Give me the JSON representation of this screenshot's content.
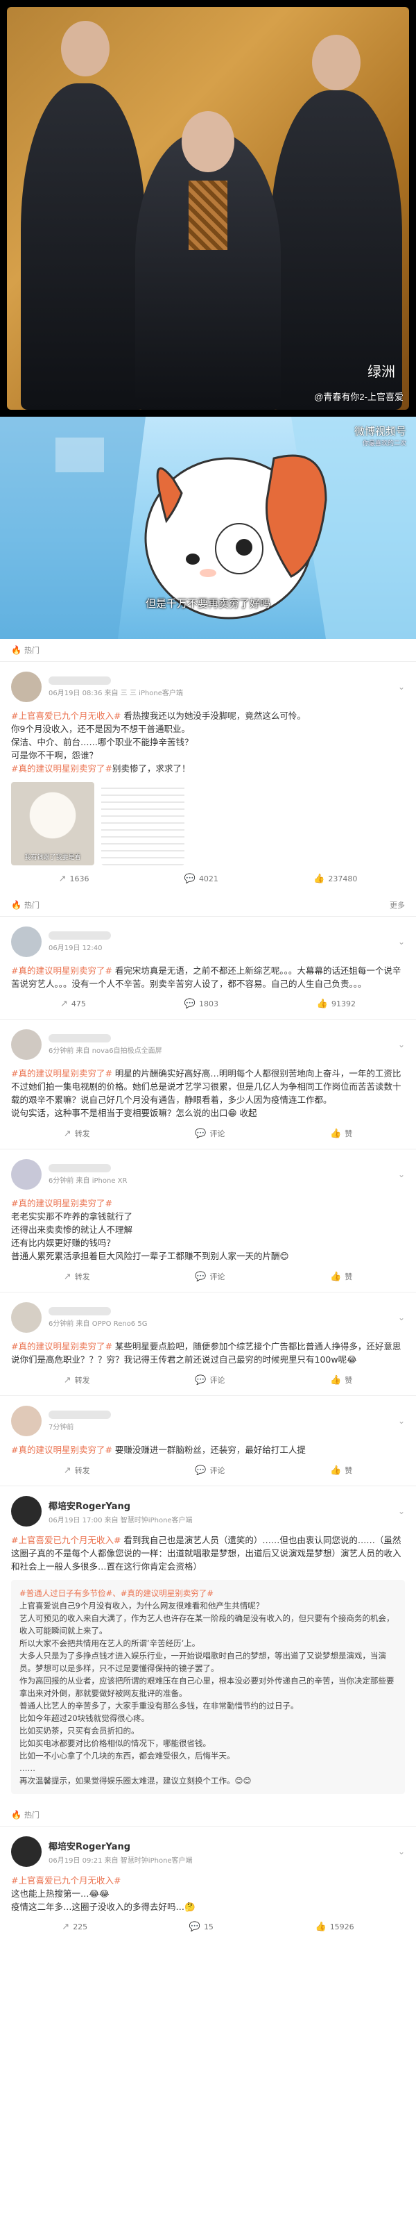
{
  "photo": {
    "watermark_logo": "绿洲",
    "watermark_account": "@青春有你2-上官喜爱"
  },
  "video": {
    "watermark": "微博视频号",
    "watermark_sub": "你最喜欢的二次",
    "subtitle": "但是千万不要再卖穷了好吗"
  },
  "hot_label": "热门",
  "more_label": "更多",
  "posts": [
    {
      "meta": "06月19日 08:36  来自 三 三  iPhone客户端",
      "lines": [
        {
          "tag": "#上官喜爱已九个月无收入#",
          "text": " 看热搜我还以为她没手没脚呢，竟然这么可怜。"
        },
        {
          "tag": "",
          "text": "你9个月没收入，还不是因为不想干普通职业。"
        },
        {
          "tag": "",
          "text": "保洁、中介、前台……哪个职业不能挣辛苦钱？"
        },
        {
          "tag": "",
          "text": "可是你不干啊，怨谁？"
        },
        {
          "tag": "#真的建议明星别卖穷了#",
          "text": "别卖惨了，求求了！"
        }
      ],
      "img1_caption": "我有钱跟了我要是看",
      "repost": "1636",
      "comment": "4021",
      "like": "237480"
    },
    {
      "meta": "06月19日 12:40",
      "lines": [
        {
          "tag": "#真的建议明星别卖穷了#",
          "text": " 看完宋坊真是无语，之前不都还上新综艺呢。。。大幕幕的话还姐每一个说辛苦说穷艺人。。。没有一个人不辛苦。别卖辛苦穷人设了，都不容易。自己的人生自己负责。。。"
        }
      ],
      "repost": "475",
      "comment": "1803",
      "like": "91392"
    },
    {
      "meta": "6分钟前  来自 nova6自拍极点全面屏",
      "lines": [
        {
          "tag": "#真的建议明星别卖穷了#",
          "text": " 明星的片酬确实好高好高…明明每个人都很别苦地向上奋斗，一年的工资比不过她们拍一集电视剧的价格。她们总是说才艺学习很累，但是几亿人为争相同工作岗位而苦苦读数十载的艰辛不累嘛？说自己好几个月没有通告，静眼看着，多少人因为疫情连工作都。"
        },
        {
          "tag": "",
          "text": "说句实话，这种事不是相当于变相要饭嘛？怎么说的出口😁 收起"
        }
      ],
      "repost": "转发",
      "comment": "评论",
      "like": "赞"
    },
    {
      "meta": "6分钟前  来自 iPhone XR",
      "lines": [
        {
          "tag": "#真的建议明星别卖穷了#",
          "text": ""
        },
        {
          "tag": "",
          "text": "老老实实那不咋养的拿钱就行了"
        },
        {
          "tag": "",
          "text": "还得出来卖卖惨的就让人不理解"
        },
        {
          "tag": "",
          "text": "还有比内娱更好赚的钱吗？"
        },
        {
          "tag": "",
          "text": "普通人累死累活承担着巨大风险打一辈子工都赚不到别人家一天的片酬😊"
        }
      ],
      "repost": "转发",
      "comment": "评论",
      "like": "赞"
    },
    {
      "meta": "6分钟前  来自 OPPO Reno6 5G",
      "lines": [
        {
          "tag": "#真的建议明星别卖穷了#",
          "text": " 某些明星要点脸吧，随便参加个综艺接个广告都比普通人挣得多，还好意思说你们是高危职业？？？穷？我记得王传君之前还说过自己最穷的时候兜里只有100w呢😂"
        }
      ],
      "repost": "转发",
      "comment": "评论",
      "like": "赞"
    },
    {
      "meta": "7分钟前",
      "lines": [
        {
          "tag": "#真的建议明星别卖穷了#",
          "text": " 要赚没赚进一群脑粉丝，还装穷，最好给打工人提"
        }
      ],
      "repost": "转发",
      "comment": "评论",
      "like": "赞"
    },
    {
      "name": "椰培安RogerYang",
      "meta": "06月19日 17:00  来自 智慧时钟iPhone客户端",
      "lines": [
        {
          "tag": "#上官喜爱已九个月无收入#",
          "text": " 看到我自己也是演艺人员（遗笑的）……但也由衷认同您说的……（虽然这圈子真的不是每个人都像您说的一样：出道就唱歌是梦想，出道后又说演戏是梦想）演艺人员的收入和社会上一般人多很多…置在这行你肯定会资格）"
        }
      ],
      "long_tags": "#普通人过日子有多节俭#、#真的建议明星别卖穷了#",
      "long_lines": [
        "上官喜爱说自己9个月没有收入，为什么网友很难看和他产生共情呢？",
        "艺人可预见的收入来自大满了，作为艺人也许存在某一阶段的确是没有收入的，但只要有个接商务的机会，收入可能瞬间就上来了。",
        "所以大家不会把共情用在艺人的所谓’辛苦经历’上。",
        "大多人只是为了多挣点钱才进入娱乐行业，一开始说唱歌时自己的梦想，等出道了又说梦想是演戏，当演员。梦想可以是多样，只不过是要懂得保持的镜子罢了。",
        "作为高回报的从业者，应该把所谓的艰难压在自己心里，根本没必要对外传递自己的辛苦，当你决定那些要拿出来对外倒，那就要做好被网友批评的准备。",
        "普通人比艺人的辛苦多了，大家手重没有那么多钱，在非常勤惜节约的过日子。",
        "比如今年超过20块钱就觉得很心疼。",
        "比如买奶茶，只买有会员折扣的。",
        "比如买电冰都要对比价格相似的情况下，哪能很省钱。",
        "比如一不小心拿了个几块的东西，都会难受很久，后悔半天。",
        "……",
        "再次温馨提示，如果觉得娱乐圈太难混，建议立刻换个工作。😊😊"
      ]
    },
    {
      "name": "椰培安RogerYang",
      "meta": "06月19日 09:21  来自 智慧时钟iPhone客户端",
      "lines": [
        {
          "tag": "#上官喜爱已九个月无收入#",
          "text": ""
        },
        {
          "tag": "",
          "text": "这也能上热搜第一…😂😂"
        },
        {
          "tag": "",
          "text": "疫情这二年多…这圈子没收入的多得去好吗…🤔"
        }
      ],
      "repost": "225",
      "comment": "15",
      "like": "15926"
    }
  ]
}
